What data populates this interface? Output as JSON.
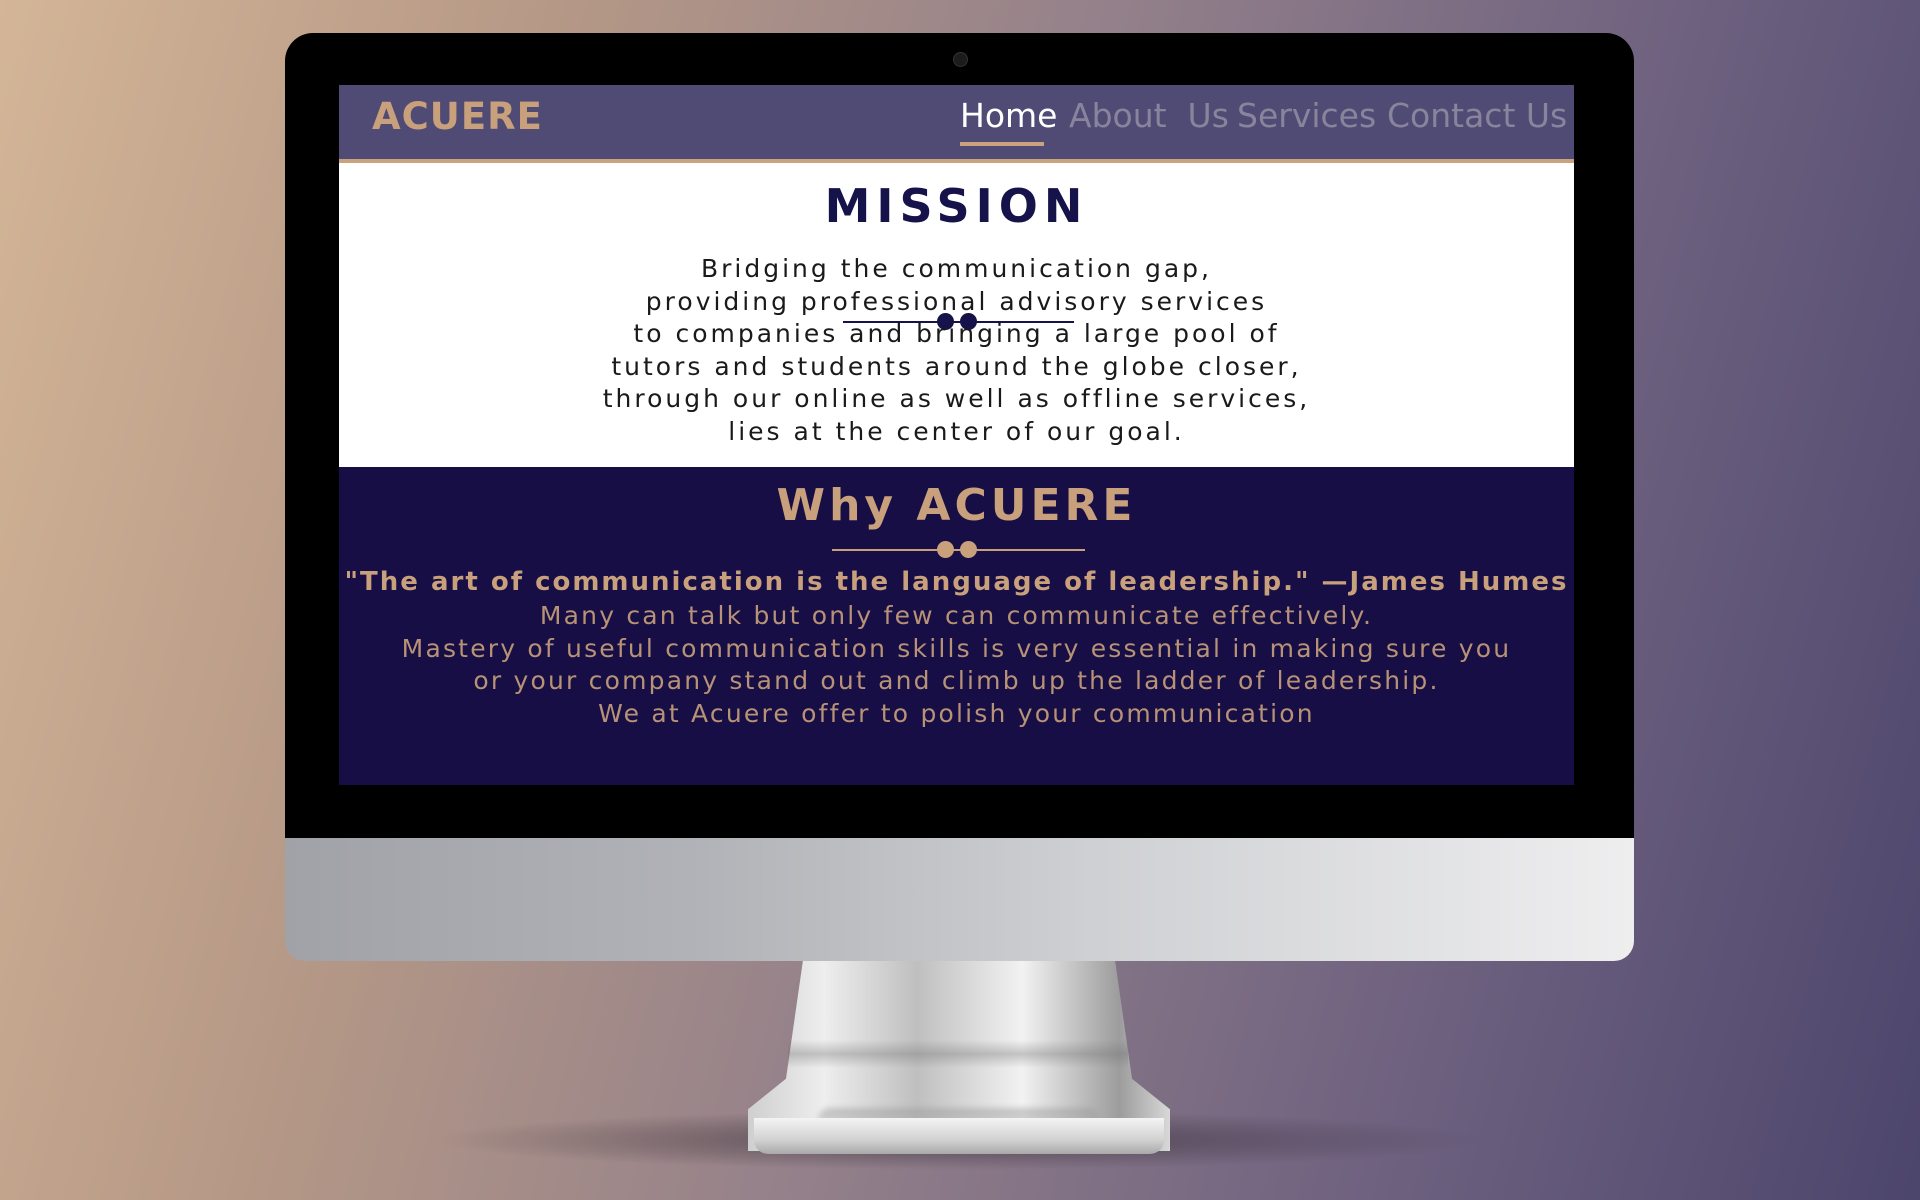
{
  "site": {
    "brand": "ACUERE",
    "nav": [
      {
        "label": "Home",
        "active": true
      },
      {
        "label": "About  Us",
        "active": false
      },
      {
        "label": "Services",
        "active": false
      },
      {
        "label": "Contact Us",
        "active": false
      }
    ]
  },
  "mission": {
    "title": "MISSION",
    "lines": [
      "Bridging the communication gap,",
      "providing professional advisory services",
      "to companies and bringing a large pool of",
      "tutors and students around the globe closer,",
      "through our online as well as offline services,",
      "lies at the center of our goal."
    ]
  },
  "why": {
    "title": "Why ACUERE",
    "quote": "\"The art of communication is the language of leadership.\" —James Humes",
    "lines": [
      "Many can talk but only few can communicate effectively.",
      "Mastery of useful communication skills is very essential in making sure you",
      "or your company stand out and climb up the ladder of leadership.",
      "We at Acuere offer to polish your communication"
    ]
  },
  "colors": {
    "navbar_bg": "#4f4b75",
    "accent_gold": "#c9a07c",
    "navy": "#160e45",
    "title_navy": "#16124a",
    "nav_inactive": "#89849b"
  }
}
